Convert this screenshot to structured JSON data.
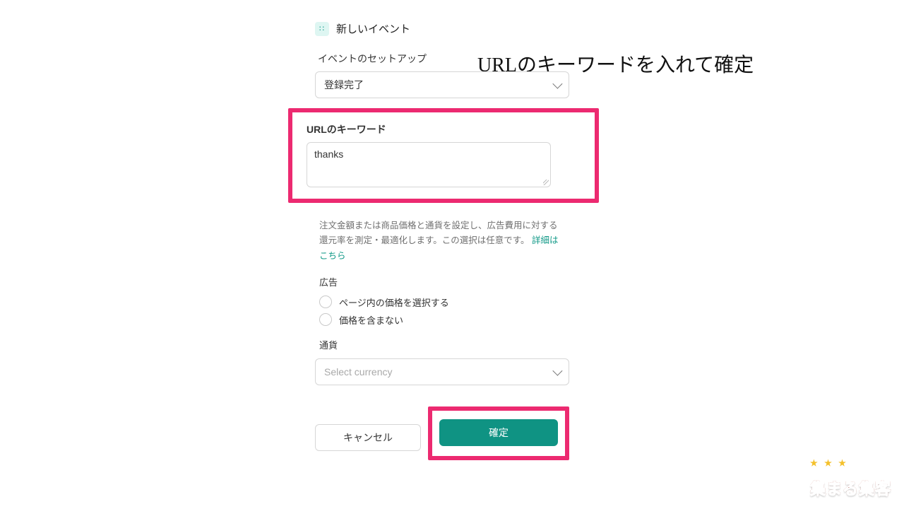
{
  "headline": "URLのキーワードを入れて確定",
  "panel": {
    "newEvent": "新しいイベント",
    "setupLabel": "イベントのセットアップ",
    "setupValue": "登録完了",
    "urlKeyword": {
      "label": "URLのキーワード",
      "value": "thanks"
    },
    "hint": {
      "text": "注文金額または商品価格と通貨を設定し、広告費用に対する還元率を測定・最適化します。この選択は任意です。",
      "linkText": "詳細はこちら"
    },
    "adGroup": {
      "label": "広告",
      "options": [
        "ページ内の価格を選択する",
        "価格を含まない"
      ]
    },
    "currency": {
      "label": "通貨",
      "placeholder": "Select currency"
    },
    "buttons": {
      "cancel": "キャンセル",
      "confirm": "確定"
    }
  },
  "watermark": "集まる集客"
}
